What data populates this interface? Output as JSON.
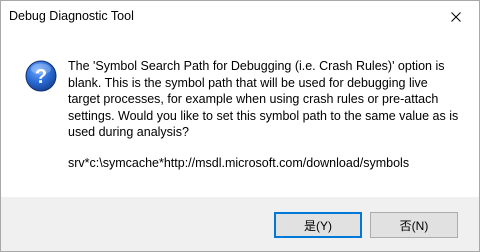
{
  "window": {
    "title": "Debug Diagnostic Tool",
    "close_icon": "close-icon"
  },
  "dialog": {
    "icon": "question-icon",
    "message": "The 'Symbol Search Path for Debugging   (i.e. Crash Rules)' option is\nblank.  This is the symbol path that will be used for debugging live\ntarget processes, for example when using crash rules or pre-attach\nsettings.  Would you like to set this symbol path to the same value as is\nused during analysis?",
    "symbol_path": "srv*c:\\symcache*http://msdl.microsoft.com/download/symbols"
  },
  "buttons": {
    "yes_label": "是(Y)",
    "no_label": "否(N)"
  },
  "colors": {
    "accent": "#0078d7",
    "footer_bg": "#f0f0f0",
    "button_bg": "#e1e1e1",
    "icon_blue": "#1f5fbf"
  }
}
